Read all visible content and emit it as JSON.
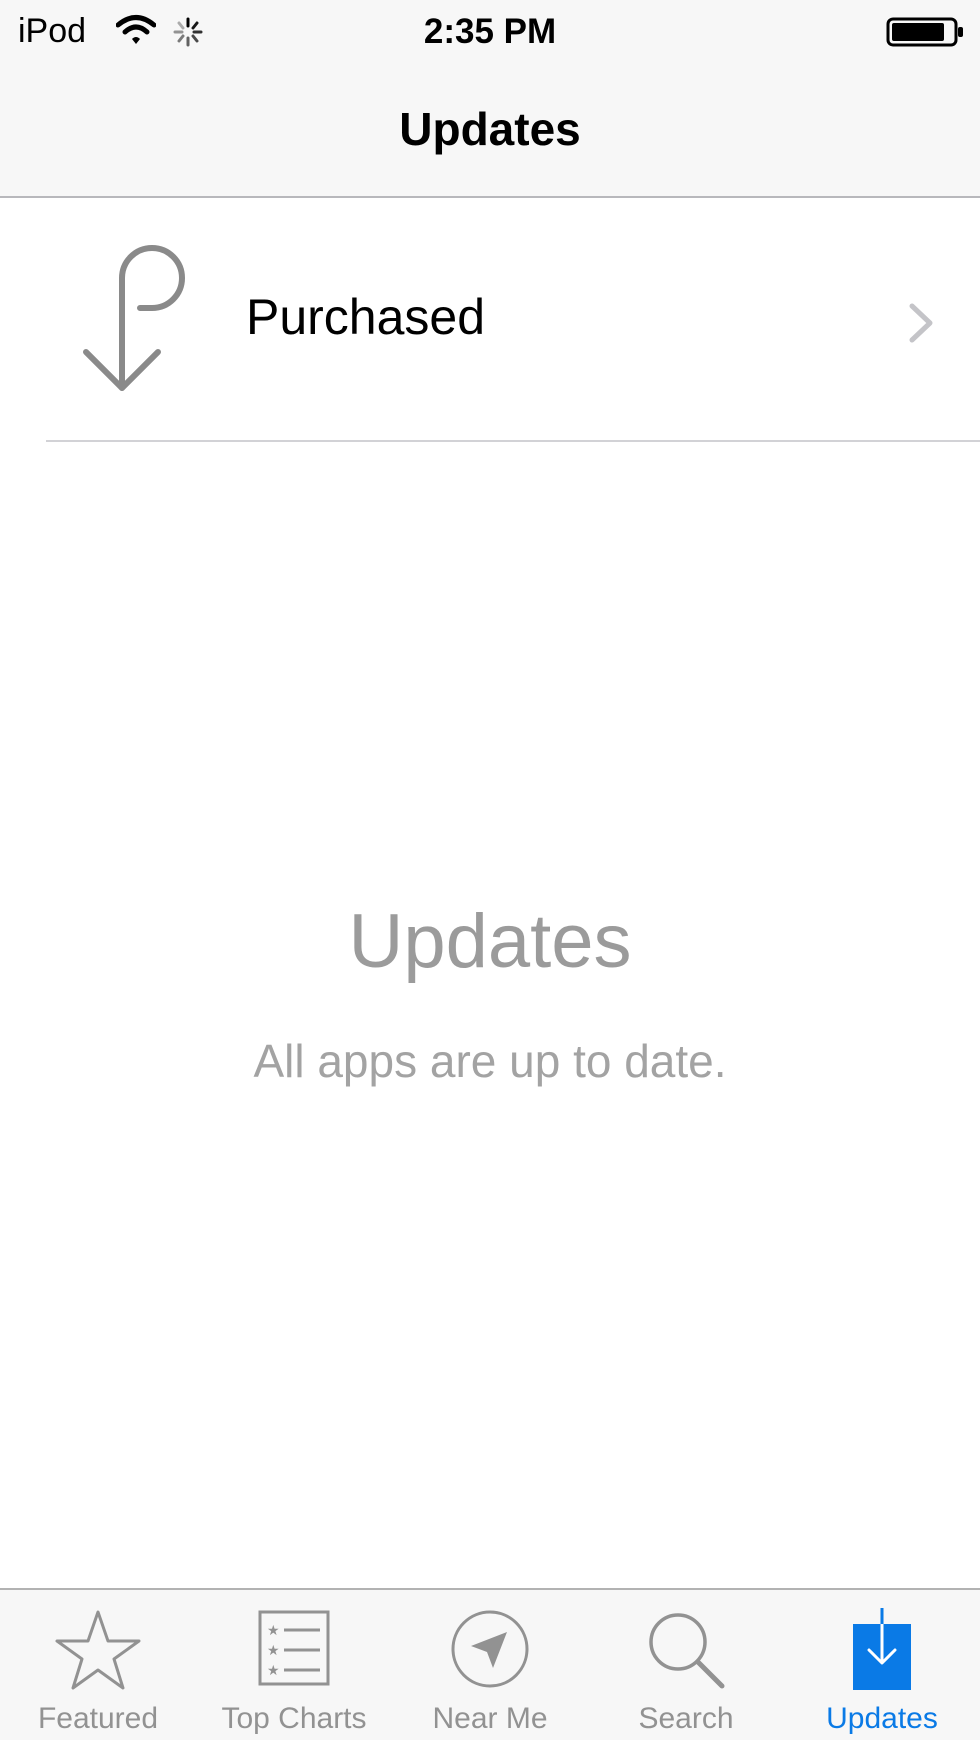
{
  "status_bar": {
    "carrier": "iPod",
    "time": "2:35 PM",
    "icons": [
      "wifi-icon",
      "activity-spinner-icon",
      "battery-icon"
    ]
  },
  "nav": {
    "title": "Updates"
  },
  "purchased": {
    "label": "Purchased",
    "icon": "purchased-arrow-icon"
  },
  "empty_state": {
    "title": "Updates",
    "subtitle": "All apps are up to date."
  },
  "tabbar": {
    "active_color": "#0a7ae6",
    "inactive_color": "#929292",
    "items": [
      {
        "label": "Featured",
        "icon": "star-icon",
        "active": false
      },
      {
        "label": "Top Charts",
        "icon": "list-icon",
        "active": false
      },
      {
        "label": "Near Me",
        "icon": "location-arrow-icon",
        "active": false
      },
      {
        "label": "Search",
        "icon": "search-icon",
        "active": false
      },
      {
        "label": "Updates",
        "icon": "download-icon",
        "active": true
      }
    ]
  }
}
